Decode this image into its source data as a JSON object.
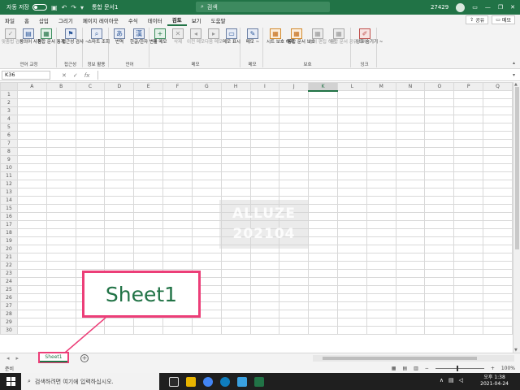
{
  "titlebar": {
    "autosave_label": "자동 저장",
    "autosave_state": "끔",
    "document_title": "통합 문서1",
    "search_placeholder": "검색",
    "user_id": "27429",
    "user_initial": "",
    "window_controls": [
      "—",
      "❐",
      "✕"
    ]
  },
  "menu": {
    "tabs": [
      "파일",
      "홈",
      "삽입",
      "그리기",
      "페이지 레이아웃",
      "수식",
      "데이터",
      "검토",
      "보기",
      "도움말"
    ],
    "active_tab": "검토",
    "share_label": "공유",
    "comments_label": "메모"
  },
  "ribbon": {
    "groups": [
      {
        "name": "언어 교정",
        "buttons": [
          {
            "label": "맞춤법 검사",
            "icon": "spellcheck-icon",
            "glyph": "✓",
            "dim": true
          },
          {
            "label": "동의어 사전",
            "icon": "thesaurus-icon",
            "glyph": "▤",
            "dim": false
          },
          {
            "label": "통합 문서 통계",
            "icon": "workbook-stats-icon",
            "glyph": "▦",
            "dim": false
          }
        ]
      },
      {
        "name": "접근성",
        "buttons": [
          {
            "label": "접근성 검사 ~",
            "icon": "accessibility-icon",
            "glyph": "⚑",
            "dim": false
          }
        ]
      },
      {
        "name": "정보 활용",
        "buttons": [
          {
            "label": "스마트 조회",
            "icon": "smart-lookup-icon",
            "glyph": "⌕",
            "dim": false
          }
        ]
      },
      {
        "name": "언어",
        "buttons": [
          {
            "label": "번역",
            "icon": "translate-icon",
            "glyph": "あ",
            "dim": false
          },
          {
            "label": "한글/한자 변환",
            "icon": "hangul-hanja-icon",
            "glyph": "漢",
            "dim": false
          }
        ]
      },
      {
        "name": "메모",
        "buttons": [
          {
            "label": "새 메모",
            "icon": "new-comment-icon",
            "glyph": "+",
            "dim": false
          },
          {
            "label": "삭제",
            "icon": "delete-comment-icon",
            "glyph": "✕",
            "dim": true
          },
          {
            "label": "이전 메모",
            "icon": "prev-comment-icon",
            "glyph": "◂",
            "dim": true
          },
          {
            "label": "다음 메모",
            "icon": "next-comment-icon",
            "glyph": "▸",
            "dim": true
          },
          {
            "label": "메모 표시",
            "icon": "show-comments-icon",
            "glyph": "▭",
            "dim": false
          }
        ]
      },
      {
        "name": "메모",
        "buttons": [
          {
            "label": "메모 ~",
            "icon": "notes-icon",
            "glyph": "✎",
            "dim": false
          }
        ]
      },
      {
        "name": "보호",
        "buttons": [
          {
            "label": "시트 보호 해제",
            "icon": "unprotect-sheet-icon",
            "glyph": "▦",
            "dim": false
          },
          {
            "label": "통합 문서 보호",
            "icon": "protect-workbook-icon",
            "glyph": "▦",
            "dim": false
          },
          {
            "label": "범위 편집 허용",
            "icon": "allow-edit-ranges-icon",
            "glyph": "▦",
            "dim": true
          },
          {
            "label": "통합 문서 공유 해제",
            "icon": "unshare-workbook-icon",
            "glyph": "▦",
            "dim": true
          }
        ]
      },
      {
        "name": "잉크",
        "buttons": [
          {
            "label": "잉크 숨기기 ~",
            "icon": "hide-ink-icon",
            "glyph": "✐",
            "dim": false
          }
        ]
      }
    ]
  },
  "formula_bar": {
    "name_box": "K36",
    "cancel_icon": "✕",
    "enter_icon": "✓",
    "fx_label": "fx",
    "value": ""
  },
  "grid": {
    "columns": [
      "A",
      "B",
      "C",
      "D",
      "E",
      "F",
      "G",
      "H",
      "I",
      "J",
      "K",
      "L",
      "M",
      "N",
      "O",
      "P",
      "Q"
    ],
    "selected_column": "K",
    "rows": [
      "1",
      "2",
      "3",
      "4",
      "5",
      "6",
      "7",
      "8",
      "9",
      "10",
      "11",
      "12",
      "13",
      "14",
      "15",
      "16",
      "17",
      "18",
      "19",
      "20",
      "21",
      "22",
      "23",
      "24",
      "25",
      "26",
      "27",
      "28",
      "29",
      "30"
    ]
  },
  "sheets": {
    "tabs": [
      "Sheet1"
    ],
    "active": "Sheet1",
    "add_label": "+"
  },
  "status": {
    "ready": "준비",
    "zoom": "100%"
  },
  "taskbar": {
    "search_placeholder": "검색하려면 여기에 입력하십시오.",
    "time": "오후 1:38",
    "date": "2021-04-24",
    "app_icon_colors": [
      "#2b2b2b",
      "#e8b400",
      "#4285f4",
      "#0f7dbd",
      "#3aa1e0",
      "#217346"
    ]
  },
  "overlay": {
    "watermark_line1": "ALLUZE",
    "watermark_line2": "202104",
    "callout_text": "Sheet1",
    "callout_color": "#ec3e78"
  }
}
